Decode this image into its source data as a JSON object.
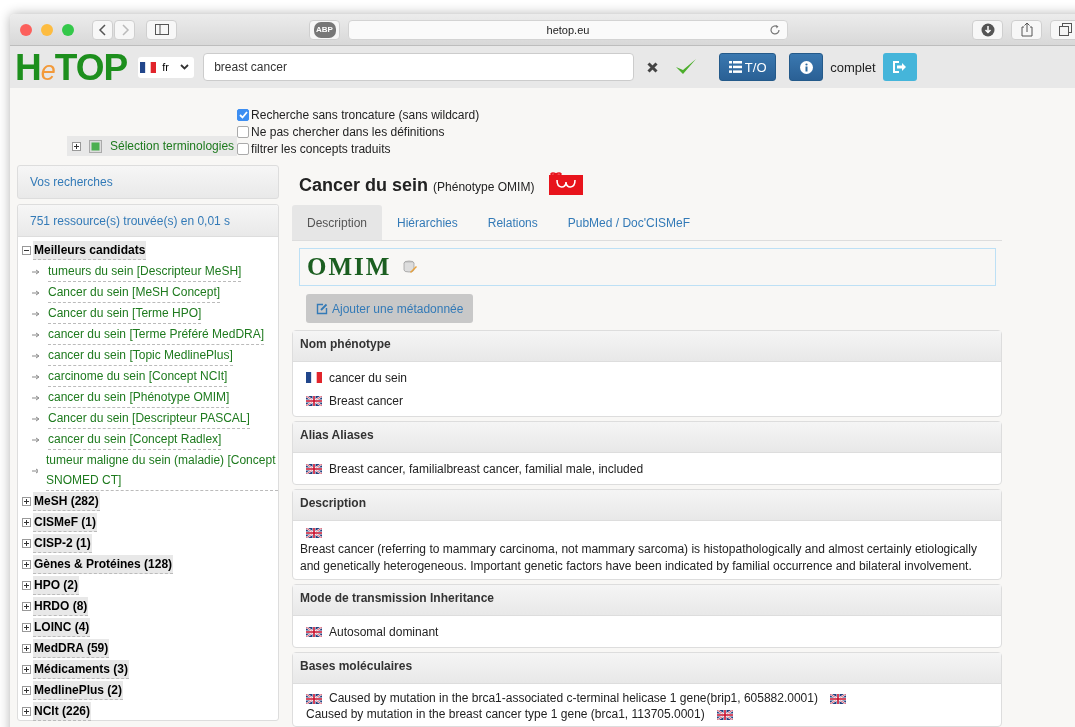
{
  "browser": {
    "abp_label": "ABP",
    "url": "hetop.eu"
  },
  "header": {
    "logo": [
      {
        "text": "H",
        "accent": false
      },
      {
        "text": "e",
        "accent": true
      },
      {
        "text": "TOP",
        "accent": false
      }
    ],
    "language": {
      "label": "fr"
    },
    "search": {
      "value": "breast cancer"
    },
    "to_button": "T/O",
    "mode_label": "complet"
  },
  "options": {
    "terminology_selection": {
      "label": "Sélection terminologies",
      "expanded": false
    },
    "checkboxes": [
      {
        "label": "Recherche sans troncature (sans wildcard)",
        "checked": true
      },
      {
        "label": "Ne pas chercher dans les définitions",
        "checked": false
      },
      {
        "label": "filtrer les concepts traduits",
        "checked": false
      }
    ]
  },
  "sidebar": {
    "history_panel": "Vos recherches",
    "results_panel": "751 ressource(s) trouvée(s) en 0,01 s",
    "tree": [
      {
        "label": "Meilleurs candidats",
        "expanded": true,
        "children": [
          {
            "label": "tumeurs du sein [Descripteur MeSH]"
          },
          {
            "label": "Cancer du sein [MeSH Concept]"
          },
          {
            "label": "Cancer du sein [Terme HPO]"
          },
          {
            "label": "cancer du sein [Terme Préféré MedDRA]"
          },
          {
            "label": "cancer du sein [Topic MedlinePlus]"
          },
          {
            "label": "carcinome du sein [Concept NCIt]"
          },
          {
            "label": "cancer du sein [Phénotype OMIM]"
          },
          {
            "label": "Cancer du sein [Descripteur PASCAL]"
          },
          {
            "label": "cancer du sein [Concept Radlex]"
          },
          {
            "label": "tumeur maligne du sein (maladie) [Concept SNOMED CT]"
          }
        ]
      },
      {
        "label": "MeSH (282)",
        "expanded": false
      },
      {
        "label": "CISMeF (1)",
        "expanded": false
      },
      {
        "label": "CISP-2 (1)",
        "expanded": false
      },
      {
        "label": "Gènes & Protéines (128)",
        "expanded": false
      },
      {
        "label": "HPO (2)",
        "expanded": false
      },
      {
        "label": "HRDO (8)",
        "expanded": false
      },
      {
        "label": "LOINC (4)",
        "expanded": false
      },
      {
        "label": "MedDRA (59)",
        "expanded": false
      },
      {
        "label": "Médicaments (3)",
        "expanded": false
      },
      {
        "label": "MedlinePlus (2)",
        "expanded": false
      },
      {
        "label": "NCIt (226)",
        "expanded": false
      }
    ]
  },
  "main": {
    "title": "Cancer du sein",
    "subtitle": "(Phénotype OMIM)",
    "tabs": [
      {
        "label": "Description",
        "selected": true
      },
      {
        "label": "Hiérarchies",
        "selected": false
      },
      {
        "label": "Relations",
        "selected": false
      },
      {
        "label": "PubMed / Doc'CISMeF",
        "selected": false
      }
    ],
    "source_logo": "OMIM",
    "add_button": "Ajouter une métadonnée",
    "sections": [
      {
        "title": "Nom phénotype",
        "kind": "list",
        "entries": [
          {
            "kind": "french",
            "text": "cancer du sein"
          },
          {
            "kind": "english",
            "text": "Breast cancer"
          }
        ]
      },
      {
        "title": "Alias Aliases",
        "kind": "list",
        "entries": [
          {
            "kind": "english",
            "text": "Breast cancer, familialbreast cancer, familial male, included"
          }
        ]
      },
      {
        "title": "Description",
        "kind": "block",
        "entries": [
          {
            "kind": "english",
            "text": "Breast cancer (referring to mammary carcinoma, not mammary sarcoma) is histopathologically and almost certainly etiologically and genetically heterogeneous. Important genetic factors have been indicated by familial occurrence and bilateral involvement."
          }
        ]
      },
      {
        "title": "Mode de transmission Inheritance",
        "kind": "list",
        "entries": [
          {
            "kind": "english",
            "text": "Autosomal dominant"
          }
        ]
      },
      {
        "title": "Bases moléculaires",
        "kind": "flow",
        "entries": [
          {
            "kind": "english",
            "text": "Caused by mutation in the brca1-associated c-terminal helicase 1 gene(brip1, 605882.0001)"
          },
          {
            "kind": "english",
            "text": "Caused by mutation in the breast cancer type 1 gene (brca1, 113705.0001)"
          }
        ]
      }
    ]
  }
}
